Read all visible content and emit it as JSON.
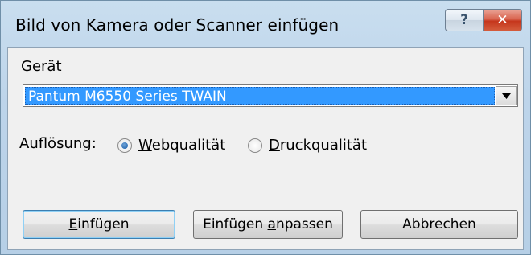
{
  "window": {
    "title": "Bild von Kamera oder Scanner einfügen",
    "help_glyph": "?",
    "close_glyph": "✕"
  },
  "device": {
    "label_accel": "G",
    "label_rest": "erät",
    "selected": "Pantum M6550 Series TWAIN"
  },
  "resolution": {
    "label": "Auflösung:",
    "options": [
      {
        "accel": "W",
        "rest": "ebqualität",
        "checked": true
      },
      {
        "accel": "D",
        "rest": "ruckqualität",
        "checked": false
      }
    ]
  },
  "buttons": {
    "insert": {
      "accel": "E",
      "rest": "infügen"
    },
    "adjust": {
      "pre": "Einfügen ",
      "accel": "a",
      "rest": "npassen"
    },
    "cancel": {
      "label": "Abbrechen"
    }
  }
}
